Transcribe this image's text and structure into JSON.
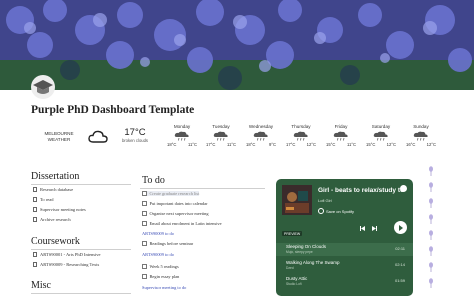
{
  "page": {
    "title": "Purple PhD Dashboard Template"
  },
  "weather": {
    "location": [
      "MELBOURNE",
      "WEATHER"
    ],
    "current_temp": "17°C",
    "current_desc": "broken clouds",
    "days": [
      {
        "name": "Monday",
        "high": "18°C",
        "low": "11°C"
      },
      {
        "name": "Tuesday",
        "high": "17°C",
        "low": "11°C"
      },
      {
        "name": "Wednesday",
        "high": "18°C",
        "low": "9°C"
      },
      {
        "name": "Thursday",
        "high": "17°C",
        "low": "12°C"
      },
      {
        "name": "Friday",
        "high": "15°C",
        "low": "11°C"
      },
      {
        "name": "Saturday",
        "high": "15°C",
        "low": "12°C"
      },
      {
        "name": "Sunday",
        "high": "16°C",
        "low": "12°C"
      }
    ]
  },
  "dissertation": {
    "heading": "Dissertation",
    "links": [
      "Research database",
      "To read",
      "Supervisor meeting notes",
      "Archive research"
    ]
  },
  "coursework": {
    "heading": "Coursework",
    "links": [
      "ARTS90001 - Arts PhD Intensive",
      "ARTS90009 - Researching Texts"
    ]
  },
  "misc": {
    "heading": "Misc"
  },
  "todo": {
    "heading": "To do",
    "items": [
      {
        "text": "Create graduate research list",
        "checked": false,
        "done": true
      },
      {
        "text": "Put important dates into calendar",
        "checked": false
      },
      {
        "text": "Organise next supervisor meeting",
        "checked": false
      },
      {
        "text": "Email about enrolment in Latin intensive",
        "checked": false
      }
    ],
    "group1": "ARTS90009 to do",
    "items2": [
      {
        "text": "Readings before seminar",
        "checked": false
      }
    ],
    "group2": "ARTS90009 to do",
    "items3": [
      {
        "text": "Week 5 readings",
        "checked": false
      },
      {
        "text": "Begin essay plan",
        "checked": false
      }
    ],
    "group3": "Supervisor meeting to do"
  },
  "spotify": {
    "title": "Girl - beats to relax/study to",
    "subtitle": "Lofi Girl",
    "save": "Save on Spotify",
    "preview": "PREVIEW",
    "tracks": [
      {
        "name": "Sleeping On Clouds",
        "artist": "Mujo, sleepy pepe",
        "duration": "02:11"
      },
      {
        "name": "Walking Along The Swamp",
        "artist": "Dzed",
        "duration": "02:14"
      },
      {
        "name": "Dusty Attic",
        "artist": "Studio Lofi",
        "duration": "01:59"
      }
    ],
    "accent": "#2f5d3d"
  }
}
